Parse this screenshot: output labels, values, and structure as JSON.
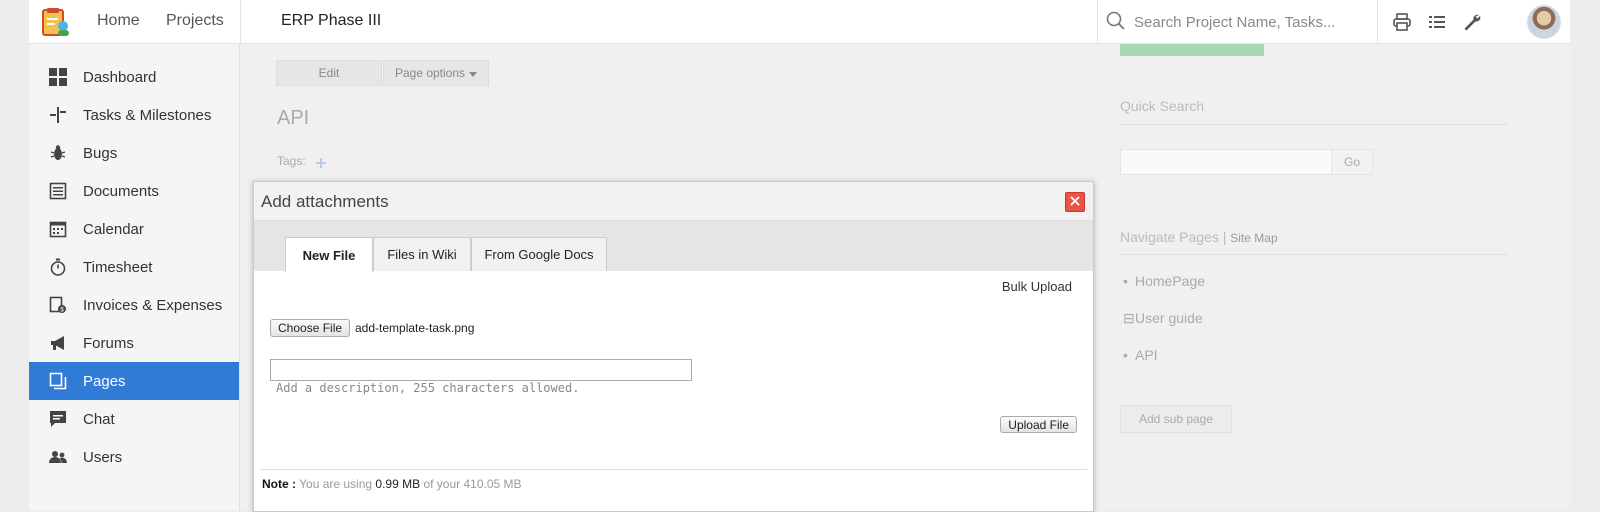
{
  "topbar": {
    "nav": [
      "Home",
      "Projects"
    ],
    "project_title": "ERP Phase III",
    "search_placeholder": "Search Project Name, Tasks..."
  },
  "sidebar": {
    "items": [
      {
        "label": "Dashboard",
        "icon": "dashboard-icon"
      },
      {
        "label": "Tasks & Milestones",
        "icon": "tasks-icon"
      },
      {
        "label": "Bugs",
        "icon": "bug-icon"
      },
      {
        "label": "Documents",
        "icon": "document-icon"
      },
      {
        "label": "Calendar",
        "icon": "calendar-icon"
      },
      {
        "label": "Timesheet",
        "icon": "stopwatch-icon"
      },
      {
        "label": "Invoices & Expenses",
        "icon": "invoice-icon"
      },
      {
        "label": "Forums",
        "icon": "megaphone-icon"
      },
      {
        "label": "Pages",
        "icon": "pages-icon",
        "active": true
      },
      {
        "label": "Chat",
        "icon": "chat-icon"
      },
      {
        "label": "Users",
        "icon": "users-icon"
      }
    ]
  },
  "main": {
    "edit_label": "Edit",
    "page_options_label": "Page options",
    "page_heading": "API",
    "tags_label": "Tags:",
    "right": {
      "quick_search_label": "Quick Search",
      "go_label": "Go",
      "navigate_pages_label": "Navigate Pages",
      "site_map_label": "Site Map",
      "pages": [
        "HomePage",
        "User guide",
        "API"
      ],
      "add_sub_page_label": "Add sub page"
    }
  },
  "dialog": {
    "title": "Add attachments",
    "tabs": [
      "New File",
      "Files in Wiki",
      "From Google Docs"
    ],
    "bulk_upload_label": "Bulk Upload",
    "choose_file_label": "Choose File",
    "selected_file": "add-template-task.png",
    "description_value": "",
    "description_hint": "Add a description, 255 characters allowed.",
    "upload_label": "Upload File",
    "note_label": "Note :",
    "note_prefix": "You are using",
    "used_storage": "0.99 MB",
    "note_middle": "of your",
    "total_storage": "410.05 MB"
  },
  "colors": {
    "accent": "#2f7bd6",
    "close_button": "#e85545",
    "create_button": "#a8d8b1"
  }
}
